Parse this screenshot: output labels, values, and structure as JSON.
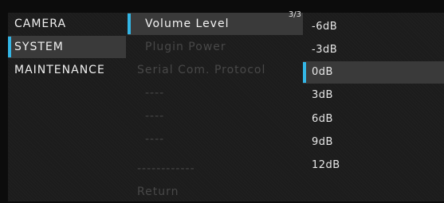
{
  "main_menu": [
    {
      "label": "CAMERA"
    },
    {
      "label": "SYSTEM"
    },
    {
      "label": "MAINTENANCE"
    }
  ],
  "submenu": {
    "page_indicator": "3/3",
    "items": [
      {
        "label": "Volume Level"
      },
      {
        "label": "Plugin Power"
      },
      {
        "label": "Serial Com. Protocol"
      },
      {
        "label": "----"
      },
      {
        "label": "----"
      },
      {
        "label": "----"
      },
      {
        "label": "------------"
      },
      {
        "label": "Return"
      }
    ]
  },
  "options": {
    "items": [
      {
        "label": "-6dB"
      },
      {
        "label": "-3dB"
      },
      {
        "label": "0dB"
      },
      {
        "label": "3dB"
      },
      {
        "label": "6dB"
      },
      {
        "label": "9dB"
      },
      {
        "label": "12dB"
      }
    ],
    "selected": "0dB"
  },
  "colors": {
    "accent": "#33b6e6",
    "selected_bg": "#3a3a3a",
    "panel_bg": "#1c1c1c"
  }
}
